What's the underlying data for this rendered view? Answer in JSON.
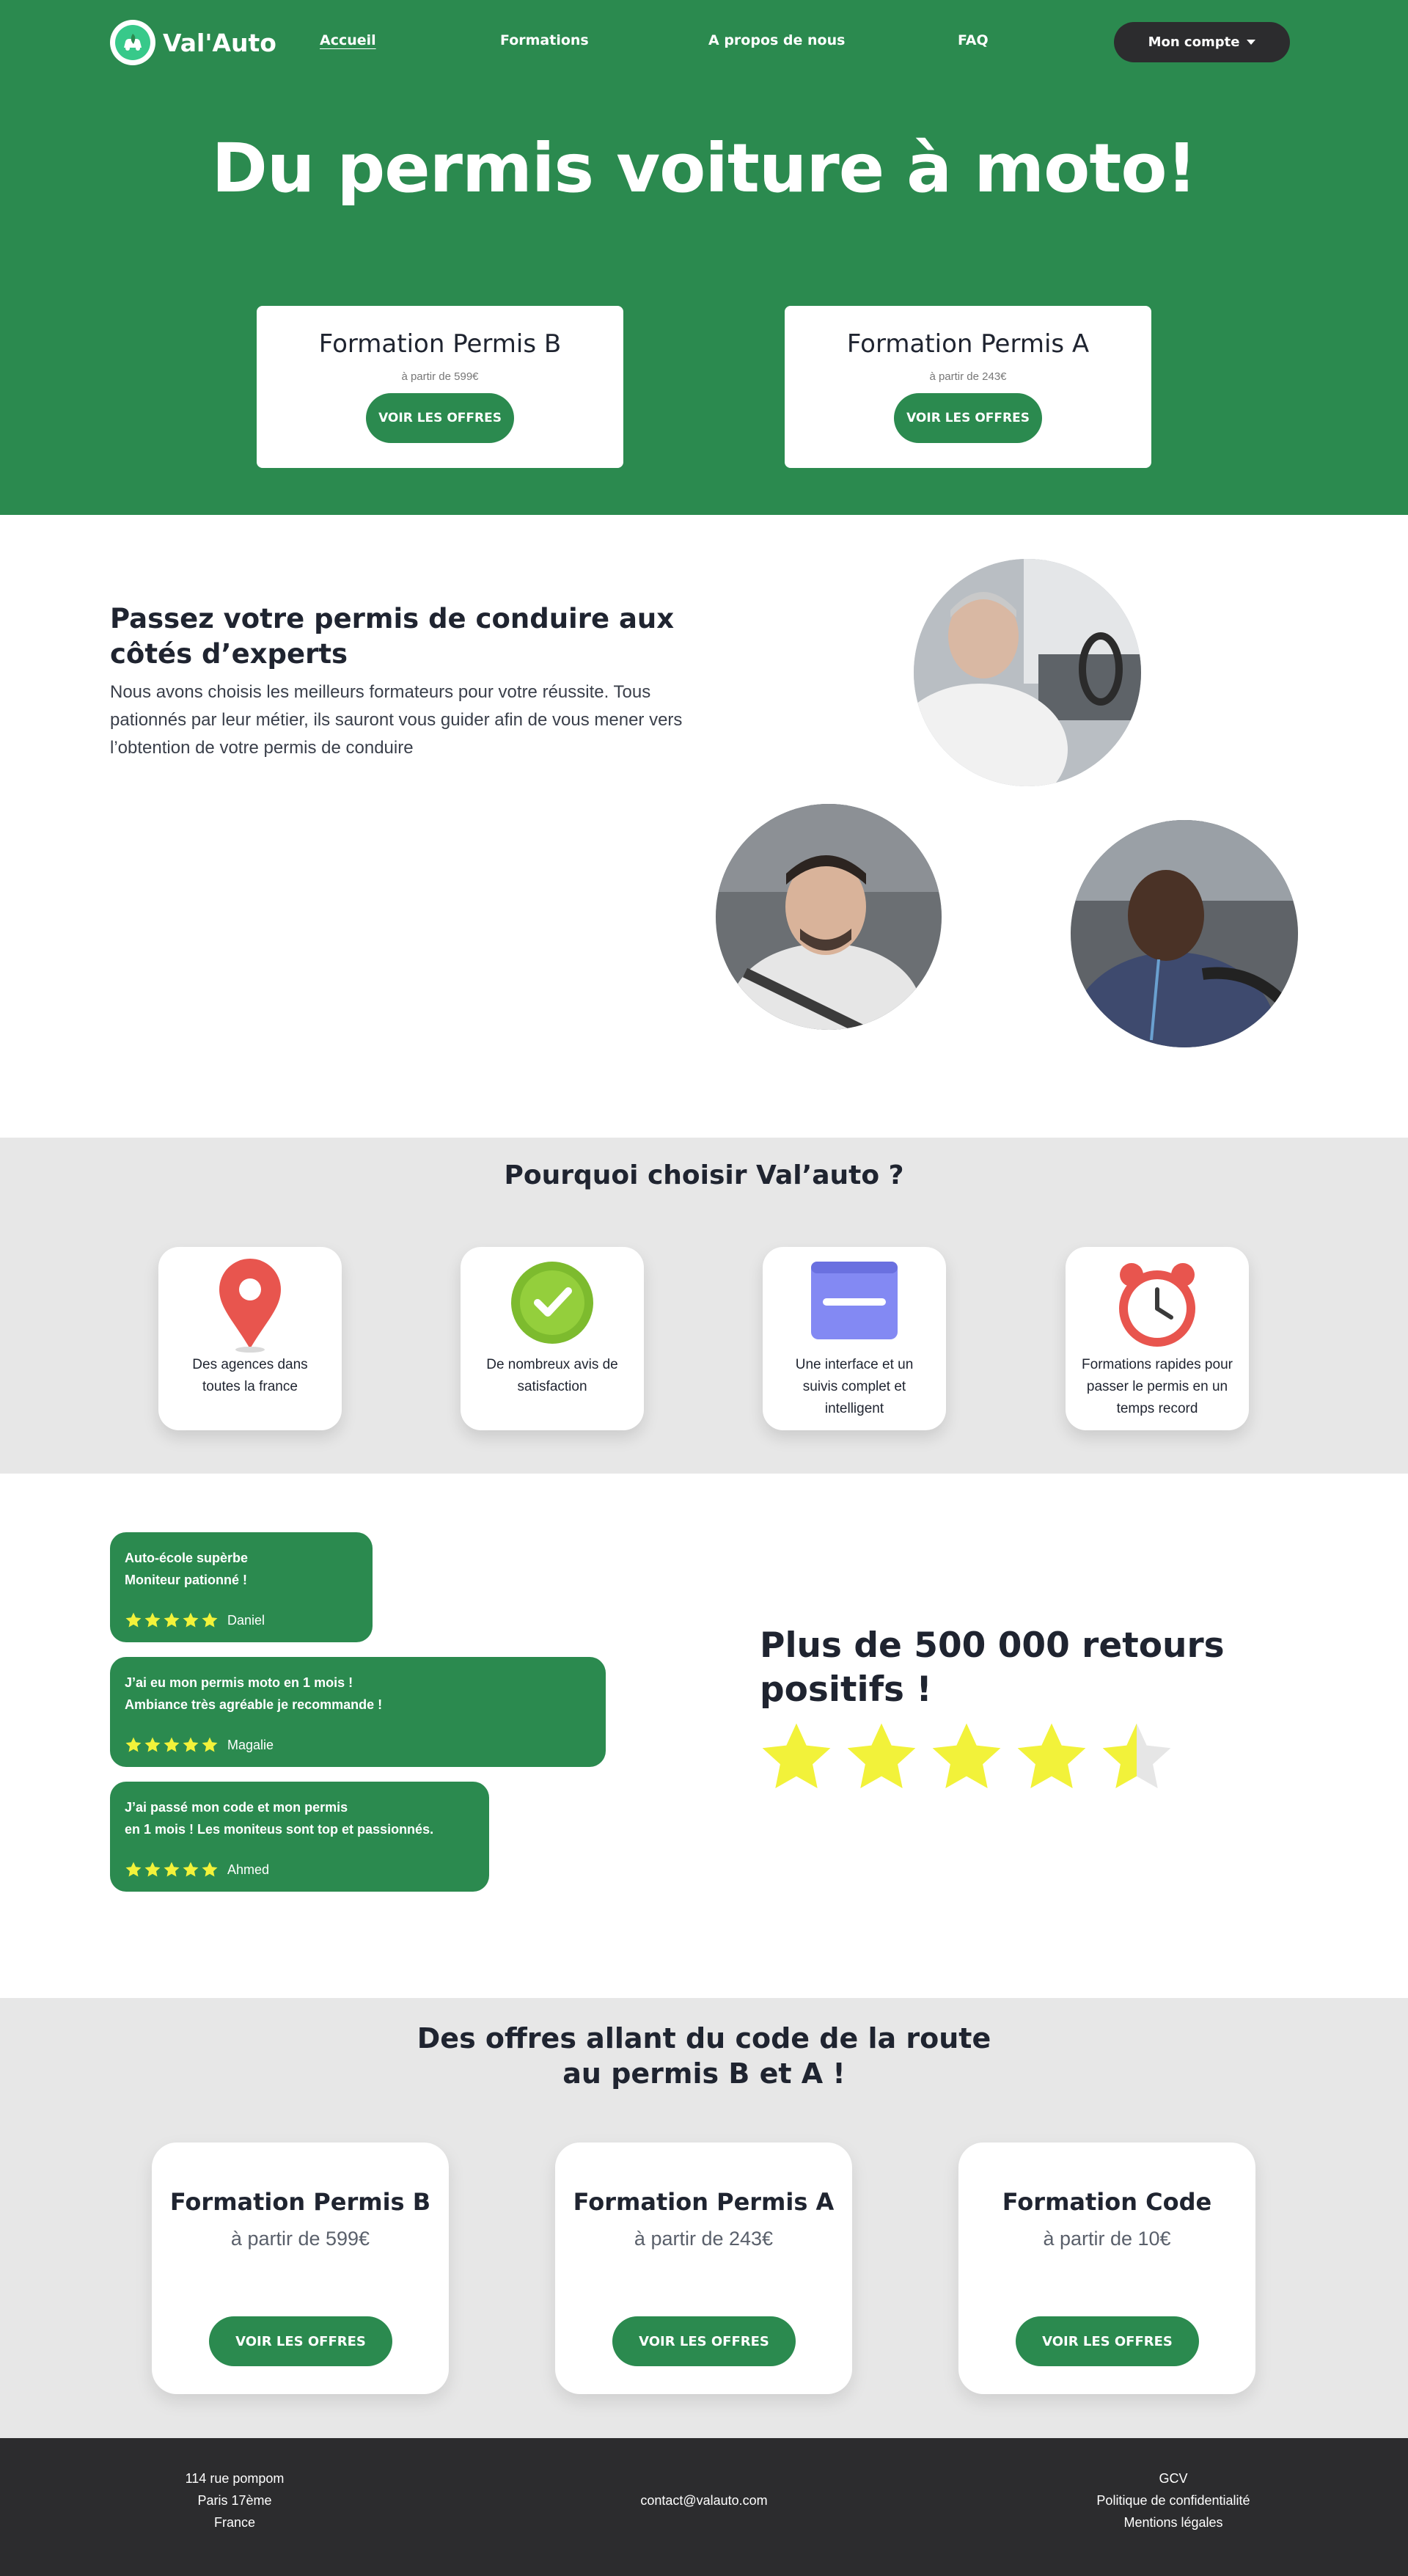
{
  "brand": {
    "name": "Val'Auto",
    "logo_icon": "car-leaf-icon",
    "primary_color": "#2b8a4f",
    "dark_color": "#2c2c2e"
  },
  "nav": {
    "items": [
      "Accueil",
      "Formations",
      "A propos de nous",
      "FAQ"
    ],
    "active": "Accueil",
    "account_label": "Mon compte"
  },
  "hero": {
    "title": "Du permis voiture à moto!",
    "cards": [
      {
        "title": "Formation Permis B",
        "price": "à partir de 599€",
        "button": "VOIR LES OFFRES"
      },
      {
        "title": "Formation Permis A",
        "price": "à partir de 243€",
        "button": "VOIR LES OFFRES"
      }
    ]
  },
  "experts": {
    "title": "Passez votre permis de conduire aux côtés d’experts",
    "text": "Nous avons choisis les meilleurs formateurs pour votre réussite. Tous pationnés par leur métier, ils sauront vous guider afin de vous mener vers l’obtention de votre permis de conduire"
  },
  "why": {
    "title": "Pourquoi choisir Val’auto ?",
    "items": [
      {
        "icon": "map-pin-icon",
        "label": "Des agences dans toutes la france"
      },
      {
        "icon": "check-badge-icon",
        "label": "De nombreux avis de satisfaction"
      },
      {
        "icon": "browser-window-icon",
        "label": "Une interface et un suivis complet et intelligent"
      },
      {
        "icon": "alarm-clock-icon",
        "label": "Formations rapides pour passer le permis en un temps record"
      }
    ]
  },
  "reviews": {
    "items": [
      {
        "line1": "Auto-école supèrbe",
        "line2": "Moniteur pationné !",
        "rating": 5,
        "author": "Daniel"
      },
      {
        "line1": "J’ai eu mon permis moto en 1 mois !",
        "line2": "Ambiance très agréable je recommande !",
        "rating": 5,
        "author": "Magalie"
      },
      {
        "line1": "J’ai passé mon code et mon permis",
        "line2": "en 1 mois ! Les moniteus sont top et passionnés.",
        "rating": 5,
        "author": "Ahmed"
      }
    ],
    "summary_title": "Plus de 500 000 retours positifs !",
    "summary_rating": 4.5,
    "star_color": "#f2f23a"
  },
  "offers": {
    "title_line1": "Des offres allant du code de la route",
    "title_line2": "au permis B et A !",
    "cards": [
      {
        "title": "Formation Permis B",
        "price": "à partir de 599€",
        "button": "VOIR LES OFFRES"
      },
      {
        "title": "Formation Permis A",
        "price": "à partir de 243€",
        "button": "VOIR LES OFFRES"
      },
      {
        "title": "Formation Code",
        "price": "à partir de 10€",
        "button": "VOIR LES OFFRES"
      }
    ]
  },
  "footer": {
    "address": [
      "114 rue pompom",
      "Paris 17ème",
      "France"
    ],
    "email": "contact@valauto.com",
    "links": [
      "GCV",
      "Politique de confidentialité",
      "Mentions légales"
    ]
  }
}
